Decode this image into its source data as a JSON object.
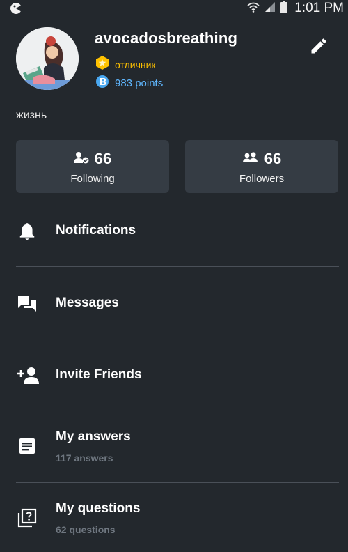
{
  "status_bar": {
    "time": "1:01 PM",
    "icons": [
      "app-icon",
      "wifi-icon",
      "signal-icon",
      "battery-icon"
    ]
  },
  "profile": {
    "username": "avocadosbreathing",
    "rank": "отличник",
    "points": "983 points",
    "bio": "жизнь",
    "colors": {
      "rank": "#ffc200",
      "points": "#5fb7ff",
      "background": "#23282d",
      "card": "#353c44"
    }
  },
  "stats": {
    "following": {
      "count": "66",
      "label": "Following"
    },
    "followers": {
      "count": "66",
      "label": "Followers"
    }
  },
  "menu": {
    "notifications": {
      "title": "Notifications",
      "icon": "bell-icon"
    },
    "messages": {
      "title": "Messages",
      "icon": "chat-icon"
    },
    "invite": {
      "title": "Invite Friends",
      "icon": "add-person-icon"
    },
    "answers": {
      "title": "My answers",
      "subtitle": "117 answers",
      "icon": "document-icon"
    },
    "questions": {
      "title": "My questions",
      "subtitle": "62 questions",
      "icon": "question-box-icon"
    }
  }
}
